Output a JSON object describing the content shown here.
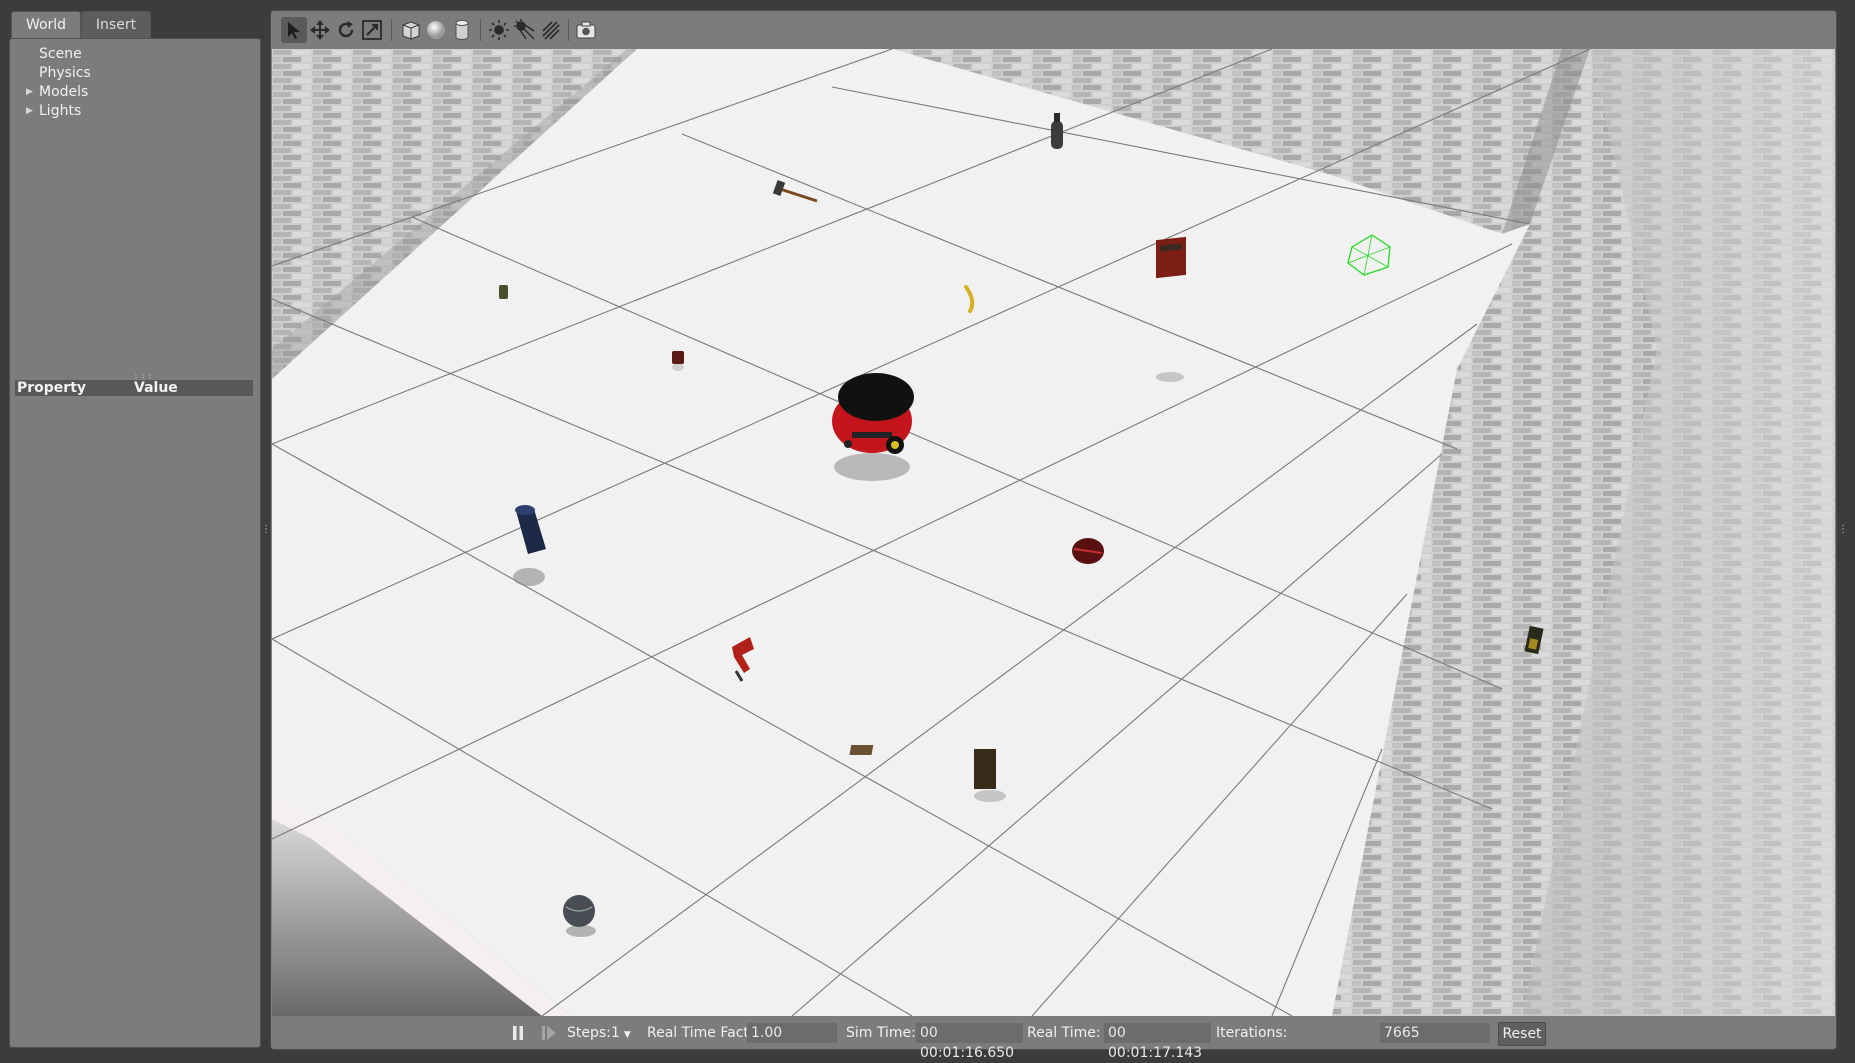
{
  "tabs": [
    {
      "label": "World"
    },
    {
      "label": "Insert"
    }
  ],
  "world_tree": [
    {
      "label": "Scene",
      "expandable": false
    },
    {
      "label": "Physics",
      "expandable": false
    },
    {
      "label": "Models",
      "expandable": true
    },
    {
      "label": "Lights",
      "expandable": true
    }
  ],
  "property_table": {
    "col_property": "Property",
    "col_value": "Value"
  },
  "toolbar": {
    "tools": [
      "select-arrow-icon",
      "translate-icon",
      "rotate-icon",
      "scale-icon",
      "box-icon",
      "sphere-icon",
      "cylinder-icon",
      "point-light-icon",
      "spot-light-icon",
      "directional-light-icon",
      "screenshot-icon"
    ],
    "selected_tool": "select-arrow-icon"
  },
  "status": {
    "pause_icon": "pause-icon",
    "step_icon": "step-icon",
    "steps_label": "Steps:",
    "steps_value": "1",
    "rtf_label": "Real Time Factor:",
    "rtf_value": "1.00",
    "sim_time_label": "Sim Time:",
    "sim_time_value": "00 00:01:16.650",
    "real_time_label": "Real Time:",
    "real_time_value": "00 00:01:17.143",
    "iterations_label": "Iterations:",
    "iterations_value": "7665",
    "reset_label": "Reset"
  },
  "scene": {
    "floor_color": "#f2f2f2",
    "grid_color": "#7a7a7a",
    "wall_color": "#c9c7c8",
    "selection_color": "#22dd22",
    "robot_color": "#c4141c"
  }
}
